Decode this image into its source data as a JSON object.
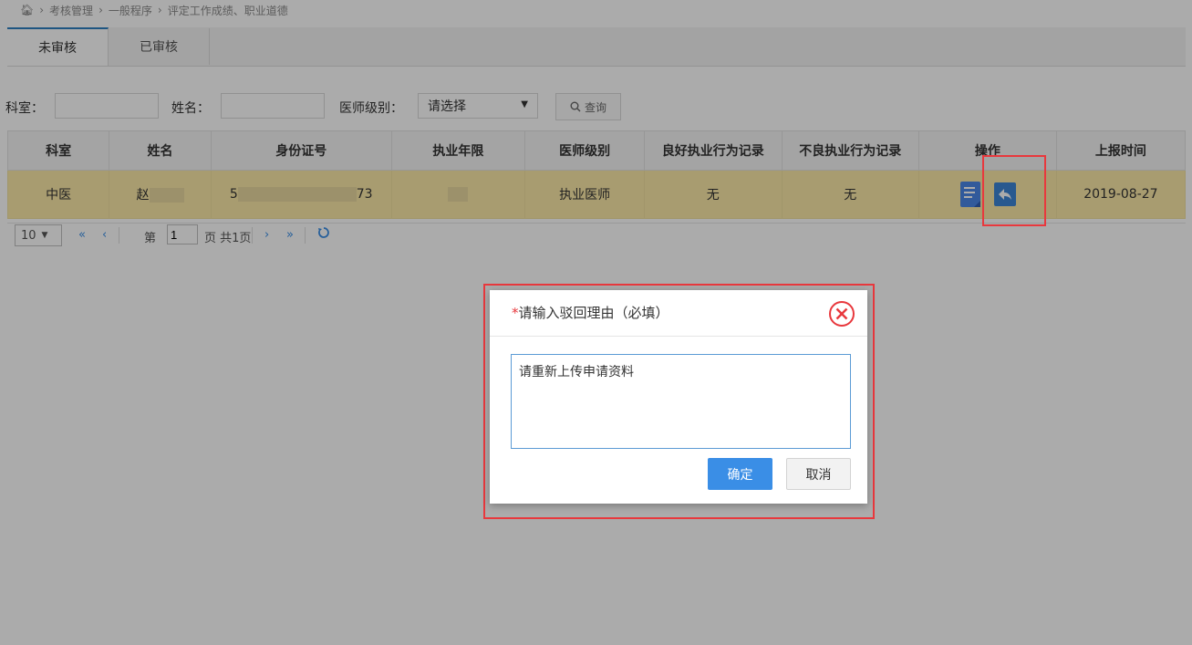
{
  "breadcrumb": {
    "home_icon": "home-icon",
    "items": [
      "考核管理",
      "一般程序",
      "评定工作成绩、职业道德"
    ],
    "separator": ">"
  },
  "tabs": [
    {
      "label": "未审核",
      "active": true
    },
    {
      "label": "已审核",
      "active": false
    }
  ],
  "filters": {
    "dept_label": "科室：",
    "name_label": "姓名：",
    "level_label": "医师级别：",
    "level_selected": "请选择",
    "query_label": "查询",
    "query_icon": "search-icon"
  },
  "table": {
    "headers": [
      "科室",
      "姓名",
      "身份证号",
      "执业年限",
      "医师级别",
      "良好执业行为记录",
      "不良执业行为记录",
      "操作",
      "上报时间"
    ],
    "rows": [
      {
        "dept": "中医",
        "name": "赵",
        "id_tail": "73",
        "id_head": "5",
        "years": "",
        "level": "执业医师",
        "good": "无",
        "bad": "无",
        "date": "2019-08-27"
      }
    ],
    "op_icons": [
      "document-icon",
      "reply-icon"
    ]
  },
  "pager": {
    "page_size": "10",
    "page_prefix": "第",
    "page_value": "1",
    "page_suffix": "页 共1页",
    "first": "«",
    "prev": "‹",
    "next": "›",
    "last": "»",
    "refresh_icon": "refresh-icon"
  },
  "dialog": {
    "required_mark": "*",
    "title": "请输入驳回理由（必填）",
    "textarea_value": "请重新上传申请资料",
    "ok_label": "确定",
    "cancel_label": "取消",
    "close_icon": "close-circle-icon"
  },
  "colors": {
    "accent": "#3a8ee6",
    "highlight_border": "#e8383d",
    "selected_row": "#fbe9a8"
  }
}
